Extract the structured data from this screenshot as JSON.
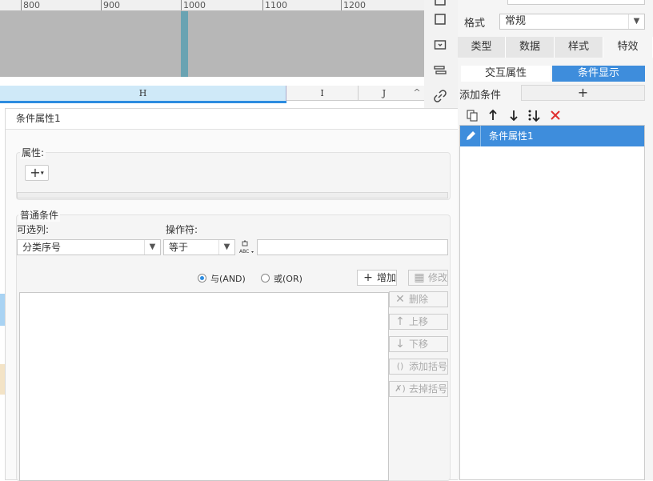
{
  "ruler": {
    "ticks": [
      "800",
      "900",
      "1000",
      "1100",
      "1200"
    ]
  },
  "sheet": {
    "columns": [
      "H",
      "I",
      "J"
    ],
    "scroll_up": "^"
  },
  "toolstrip": {
    "icons": [
      "window-icon",
      "square-icon",
      "dropdown-box-icon",
      "list-icon",
      "link-icon"
    ]
  },
  "dialog": {
    "title": "条件属性1",
    "attr_group": {
      "label": "属性:",
      "add_symbol": "+"
    },
    "cond_group": {
      "label": "普通条件",
      "column_label": "可选列:",
      "column_value": "分类序号",
      "operator_label": "操作符:",
      "operator_value": "等于",
      "value_input": "",
      "and_label": "与(AND)",
      "or_label": "或(OR)",
      "add_label": "增加",
      "modify_label": "修改",
      "delete_label": "删除",
      "up_label": "上移",
      "down_label": "下移",
      "add_bracket_label": "添加括号",
      "remove_bracket_label": "去掉括号"
    }
  },
  "right_panel": {
    "format_label": "格式",
    "format_value": "常规",
    "tabs": [
      "类型",
      "数据",
      "样式",
      "特效"
    ],
    "subtabs": [
      "交互属性",
      "条件显示"
    ],
    "add_condition_label": "添加条件",
    "add_symbol": "+",
    "list_items": [
      "条件属性1"
    ],
    "colors": {
      "accent": "#3e8ddc",
      "delete": "#e03030"
    }
  }
}
